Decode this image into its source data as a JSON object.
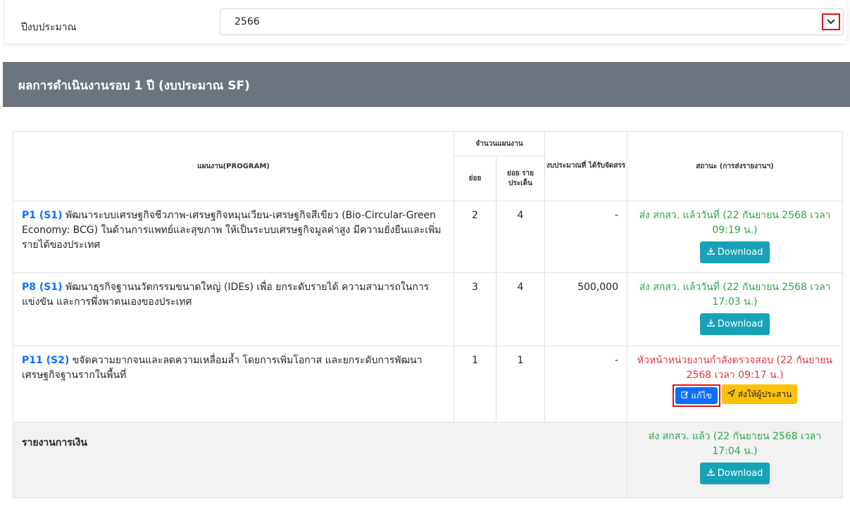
{
  "filter": {
    "label": "ปีงบประมาณ",
    "selected_year": "2566"
  },
  "panel": {
    "title": "ผลการดำเนินงานรอบ 1 ปี (งบประมาณ SF)"
  },
  "table": {
    "headers": {
      "program": "แผนงาน(PROGRAM)",
      "count_group": "จำนวนแผนงาน",
      "sub": "ย่อย",
      "sub_issue": "ย่อย ราย ประเด็น",
      "budget": "งบประมาณที่ ได้รับจัดสรร",
      "status": "สถานะ (การส่งรายงานฯ)"
    },
    "rows": [
      {
        "code": "P1 (S1)",
        "name": " พัฒนาระบบเศรษฐกิจชีวภาพ-เศรษฐกิจหมุนเวียน-เศรษฐกิจสีเขียว (Bio-Circular-Green Economy: BCG) ในด้านการแพทย์และสุขภาพ ให้เป็นระบบเศรษฐกิจมูลค่าสูง มีความยั่งยืนและเพิ่มรายได้ของประเทศ",
        "sub": "2",
        "sub_issue": "4",
        "budget": "-",
        "status": "ส่ง สกสว. แล้ววันที่ (22 กันยายน 2568 เวลา 09:19 น.)",
        "download_label": "Download"
      },
      {
        "code": "P8 (S1)",
        "name": " พัฒนาธุรกิจฐานนวัตกรรมขนาดใหญ่ (IDEs) เพื่อ ยกระดับรายได้ ความสามารถในการแข่งขัน และการพึ่งพาตนเองของประเทศ",
        "sub": "3",
        "sub_issue": "4",
        "budget": "500,000",
        "status": "ส่ง สกสว. แล้ววันที่ (22 กันยายน 2568 เวลา 17:03 น.)",
        "download_label": "Download"
      },
      {
        "code": "P11 (S2)",
        "name": " ขจัดความยากจนและลดความเหลื่อมล้ำ โดยการเพิ่มโอกาส และยกระดับการพัฒนาเศรษฐกิจฐานรากในพื้นที่",
        "sub": "1",
        "sub_issue": "1",
        "budget": "-",
        "status": "หัวหน้าหน่วยงานกำลังตรวจสอบ (22 กันยายน 2568 เวลา 09:17 น.)",
        "edit_label": "แก้ไข",
        "send_label": "ส่งให้ผู้ประสาน"
      }
    ],
    "finance": {
      "label": "รายงานการเงิน",
      "status": "ส่ง สกสว. แล้ว (22 กันยายน 2568 เวลา 17:04 น.)",
      "download_label": "Download"
    }
  },
  "colors": {
    "header_bg": "#6c757d",
    "link_blue": "#0d6efd",
    "status_green": "#28a745",
    "status_red": "#dc3545",
    "download_teal": "#17a2b8",
    "send_yellow": "#ffc107",
    "highlight_red": "#e0141e"
  }
}
